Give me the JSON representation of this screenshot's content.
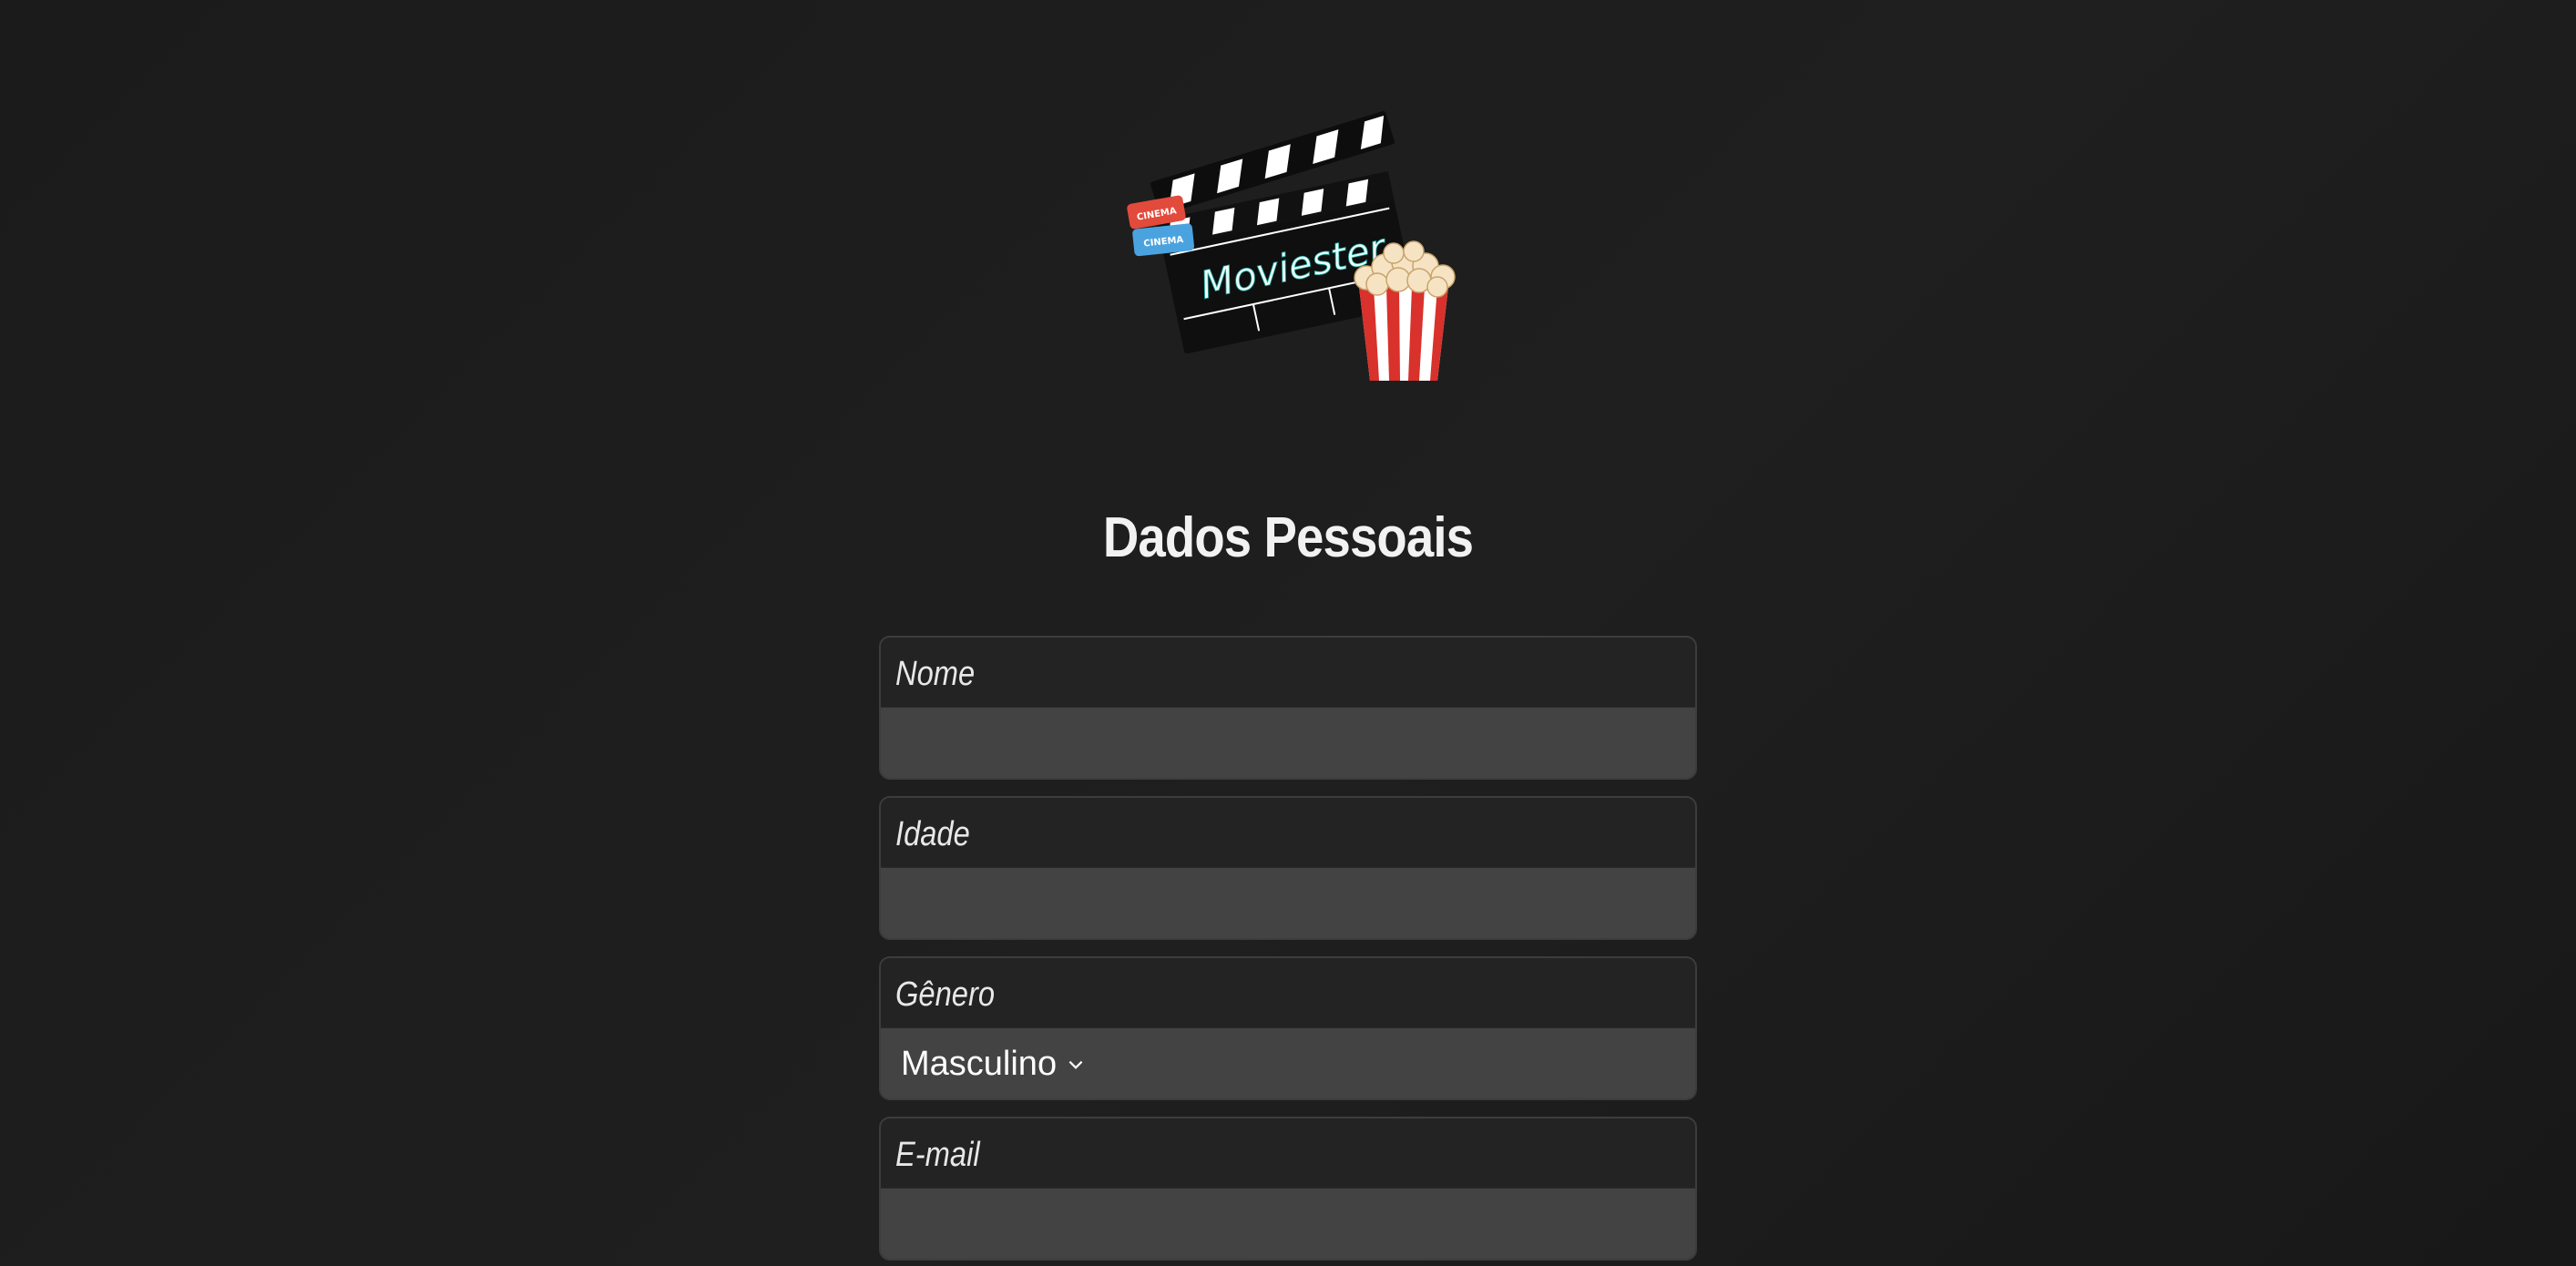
{
  "logo": {
    "text": "Moviester",
    "ticket_text": "CINEMA"
  },
  "page_title": "Dados Pessoais",
  "form": {
    "fields": [
      {
        "label": "Nome",
        "value": ""
      },
      {
        "label": "Idade",
        "value": ""
      },
      {
        "label": "Gênero",
        "selected": "Masculino"
      },
      {
        "label": "E-mail",
        "value": ""
      }
    ]
  },
  "colors": {
    "background": "#1c1c1c",
    "field_label_bg": "#232323",
    "field_input_bg": "#434343",
    "text": "#f2f2f2",
    "ticket_red": "#e24a3b",
    "ticket_blue": "#4aa3df",
    "popcorn_red": "#d9312b"
  },
  "icons": {
    "logo": "clapperboard-popcorn-logo",
    "dropdown": "chevron-down-icon"
  }
}
